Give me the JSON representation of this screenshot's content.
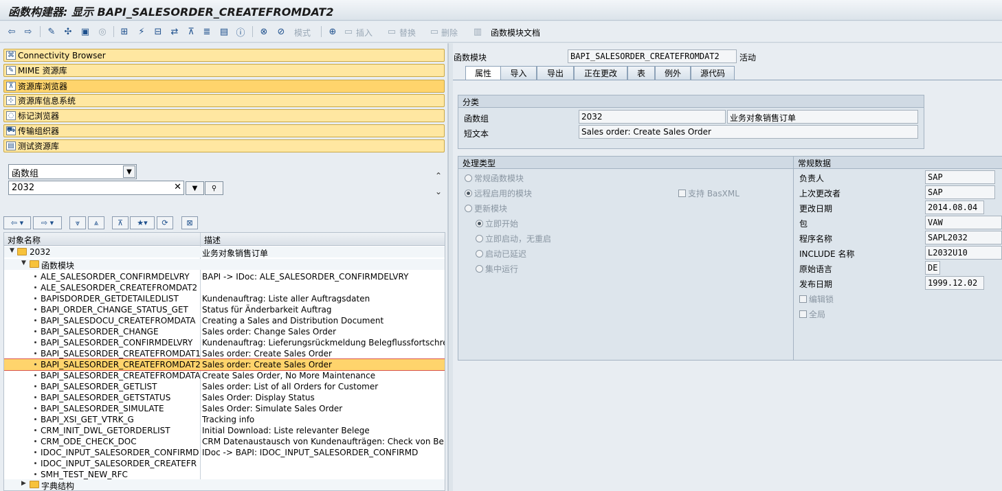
{
  "window": {
    "title": "函数构建器: 显示 BAPI_SALESORDER_CREATEFROMDAT2"
  },
  "toolbar": {
    "pattern_label": "模式",
    "insert_label": "插入",
    "replace_label": "替换",
    "delete_label": "删除",
    "docs_label": "函数模块文档"
  },
  "nav": [
    {
      "label": "Connectivity Browser",
      "icon": "connectivity-icon"
    },
    {
      "label": "MIME 资源库",
      "icon": "mime-icon"
    },
    {
      "label": "资源库浏览器",
      "icon": "repository-browser-icon"
    },
    {
      "label": "资源库信息系统",
      "icon": "info-system-icon"
    },
    {
      "label": "标记浏览器",
      "icon": "tag-browser-icon"
    },
    {
      "label": "传输组织器",
      "icon": "transport-icon"
    },
    {
      "label": "测试资源库",
      "icon": "test-repository-icon"
    }
  ],
  "object_selector": {
    "type_value": "函数组",
    "name_value": "2032"
  },
  "tree": {
    "col_name": "对象名称",
    "col_desc": "描述",
    "root": {
      "name": "2032",
      "desc": "业务对象销售订单"
    },
    "folder_fm": "函数模块",
    "items": [
      {
        "name": "ALE_SALESORDER_CONFIRMDELVRY",
        "desc": "BAPI -> IDoc: ALE_SALESORDER_CONFIRMDELVRY"
      },
      {
        "name": "ALE_SALESORDER_CREATEFROMDAT2",
        "desc": ""
      },
      {
        "name": "BAPISDORDER_GETDETAILEDLIST",
        "desc": "Kundenauftrag: Liste aller Auftragsdaten"
      },
      {
        "name": "BAPI_ORDER_CHANGE_STATUS_GET",
        "desc": "Status für Änderbarkeit Auftrag"
      },
      {
        "name": "BAPI_SALESDOCU_CREATEFROMDATA",
        "desc": "Creating a Sales and Distribution Document"
      },
      {
        "name": "BAPI_SALESORDER_CHANGE",
        "desc": "Sales order: Change Sales Order"
      },
      {
        "name": "BAPI_SALESORDER_CONFIRMDELVRY",
        "desc": "Kundenauftrag: Lieferungsrückmeldung Belegflussfortschreibung"
      },
      {
        "name": "BAPI_SALESORDER_CREATEFROMDAT1",
        "desc": "Sales order: Create Sales Order"
      },
      {
        "name": "BAPI_SALESORDER_CREATEFROMDAT2",
        "desc": "Sales order: Create Sales Order"
      },
      {
        "name": "BAPI_SALESORDER_CREATEFROMDATA",
        "desc": "Create Sales Order, No More Maintenance"
      },
      {
        "name": "BAPI_SALESORDER_GETLIST",
        "desc": "Sales order: List of all Orders for Customer"
      },
      {
        "name": "BAPI_SALESORDER_GETSTATUS",
        "desc": "Sales Order: Display Status"
      },
      {
        "name": "BAPI_SALESORDER_SIMULATE",
        "desc": "Sales Order: Simulate Sales Order"
      },
      {
        "name": "BAPI_XSI_GET_VTRK_G",
        "desc": "Tracking info"
      },
      {
        "name": "CRM_INIT_DWL_GETORDERLIST",
        "desc": "Initial Download: Liste relevanter Belege"
      },
      {
        "name": "CRM_ODE_CHECK_DOC",
        "desc": "CRM Datenaustausch von Kundenaufträgen: Check von Belegen"
      },
      {
        "name": "IDOC_INPUT_SALESORDER_CONFIRMD",
        "desc": "IDoc -> BAPI: IDOC_INPUT_SALESORDER_CONFIRMD"
      },
      {
        "name": "IDOC_INPUT_SALESORDER_CREATEFR",
        "desc": ""
      },
      {
        "name": "SMH_TEST_NEW_RFC",
        "desc": ""
      }
    ],
    "folder_dict": "字典结构"
  },
  "header": {
    "fm_label": "函数模块",
    "fm_value": "BAPI_SALESORDER_CREATEFROMDAT2",
    "status": "活动"
  },
  "tabs": [
    "属性",
    "导入",
    "导出",
    "正在更改",
    "表",
    "例外",
    "源代码"
  ],
  "classification": {
    "title": "分类",
    "fg_label": "函数组",
    "fg_value": "2032",
    "fg_desc": "业务对象销售订单",
    "short_label": "短文本",
    "short_value": "Sales order: Create Sales Order"
  },
  "processing": {
    "title": "处理类型",
    "normal": "常规函数模块",
    "remote": "远程启用的模块",
    "basxml": "支持 BasXML",
    "update": "更新模块",
    "immediate": "立即开始",
    "immediate_norestart": "立即启动，无重启",
    "delayed": "启动已延迟",
    "collective": "集中运行"
  },
  "general": {
    "title": "常规数据",
    "owner_label": "负责人",
    "owner_value": "SAP",
    "changed_by_label": "上次更改者",
    "changed_by_value": "SAP",
    "changed_on_label": "更改日期",
    "changed_on_value": "2014.08.04",
    "package_label": "包",
    "package_value": "VAW",
    "program_label": "程序名称",
    "program_value": "SAPL2032",
    "include_label": "INCLUDE 名称",
    "include_value": "L2032U10",
    "lang_label": "原始语言",
    "lang_value": "DE",
    "release_label": "发布日期",
    "release_value": "1999.12.02",
    "edit_lock": "编辑锁",
    "global": "全局"
  }
}
